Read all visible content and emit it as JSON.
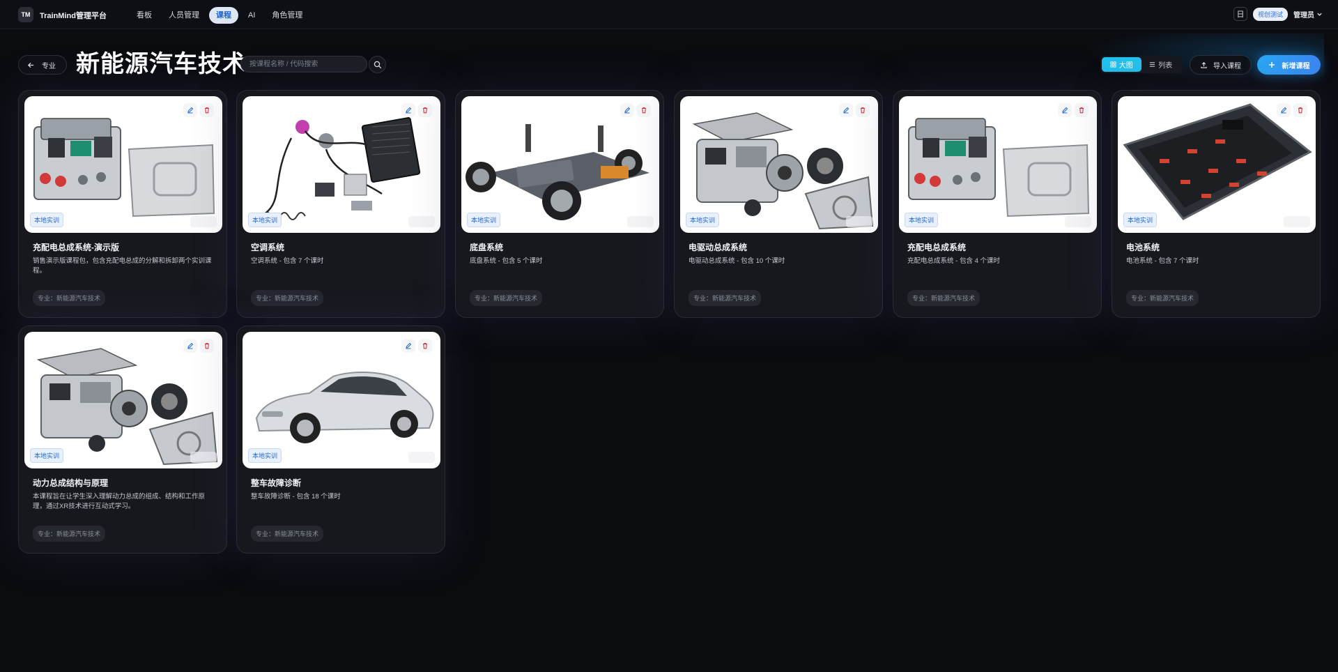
{
  "app": {
    "logo": "TM",
    "name": "TrainMind管理平台"
  },
  "nav": {
    "items": [
      {
        "label": "看板",
        "active": false
      },
      {
        "label": "人员管理",
        "active": false
      },
      {
        "label": "课程",
        "active": true
      },
      {
        "label": "AI",
        "active": false
      },
      {
        "label": "角色管理",
        "active": false
      }
    ]
  },
  "topright": {
    "calendar_icon": "日",
    "env_badge": "视创测试",
    "user": "管理员"
  },
  "header": {
    "back_label": "专业",
    "title": "新能源汽车技术",
    "search_placeholder": "按课程名称 / 代码搜索",
    "view_grid": "大图",
    "view_list": "列表",
    "import": "导入课程",
    "add": "新增课程"
  },
  "courses": [
    {
      "title": "充配电总成系统-演示版",
      "desc": "销售演示版课程包，包含充配电总成的分解和拆卸两个实训课程。",
      "tag": "本地实训",
      "major": "专业：新能源汽车技术",
      "image": "charger-assembly"
    },
    {
      "title": "空调系统",
      "desc": "空调系统 - 包含 7 个课时",
      "tag": "本地实训",
      "major": "专业：新能源汽车技术",
      "image": "ac-system"
    },
    {
      "title": "底盘系统",
      "desc": "底盘系统 - 包含 5 个课时",
      "tag": "本地实训",
      "major": "专业：新能源汽车技术",
      "image": "chassis"
    },
    {
      "title": "电驱动总成系统",
      "desc": "电驱动总成系统 - 包含 10 个课时",
      "tag": "本地实训",
      "major": "专业：新能源汽车技术",
      "image": "e-drive"
    },
    {
      "title": "充配电总成系统",
      "desc": "充配电总成系统 - 包含 4 个课时",
      "tag": "本地实训",
      "major": "专业：新能源汽车技术",
      "image": "charger-assembly"
    },
    {
      "title": "电池系统",
      "desc": "电池系统 - 包含 7 个课时",
      "tag": "本地实训",
      "major": "专业：新能源汽车技术",
      "image": "battery-pack"
    },
    {
      "title": "动力总成结构与原理",
      "desc": "本课程旨在让学生深入理解动力总成的组成、结构和工作原理，通过XR技术进行互动式学习。",
      "tag": "本地实训",
      "major": "专业：新能源汽车技术",
      "image": "e-drive"
    },
    {
      "title": "整车故障诊断",
      "desc": "整车故障诊断 - 包含 18 个课时",
      "tag": "本地实训",
      "major": "专业：新能源汽车技术",
      "image": "sedan"
    }
  ]
}
